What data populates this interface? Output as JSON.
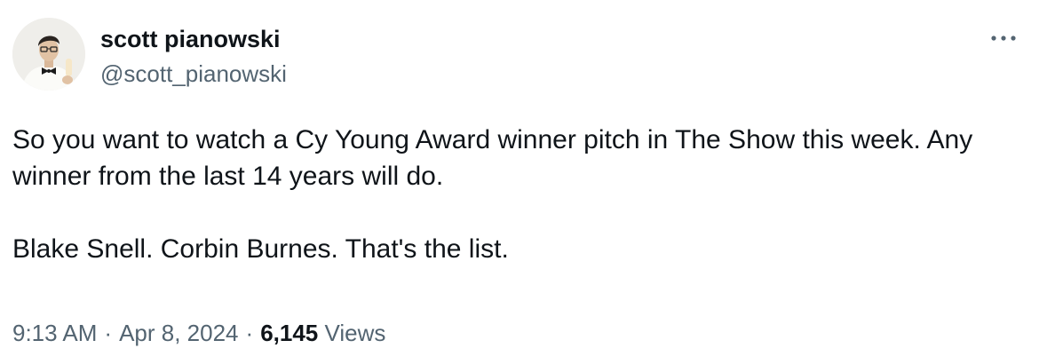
{
  "tweet": {
    "author": {
      "display_name": "scott pianowski",
      "handle": "@scott_pianowski"
    },
    "icons": {
      "more": "more-horizontal-icon",
      "avatar": "profile-photo"
    },
    "text": {
      "line1": "So you want to watch a Cy Young Award winner pitch in The Show this week. Any winner from the last 14 years will do.",
      "line2": "Blake Snell. Corbin Burnes. That's the list."
    },
    "meta": {
      "time": "9:13 AM",
      "separator": "·",
      "date": "Apr 8, 2024",
      "views_count": "6,145",
      "views_label": "Views"
    },
    "colors": {
      "primary_text": "#0f1419",
      "secondary_text": "#536471",
      "background": "#ffffff"
    }
  }
}
